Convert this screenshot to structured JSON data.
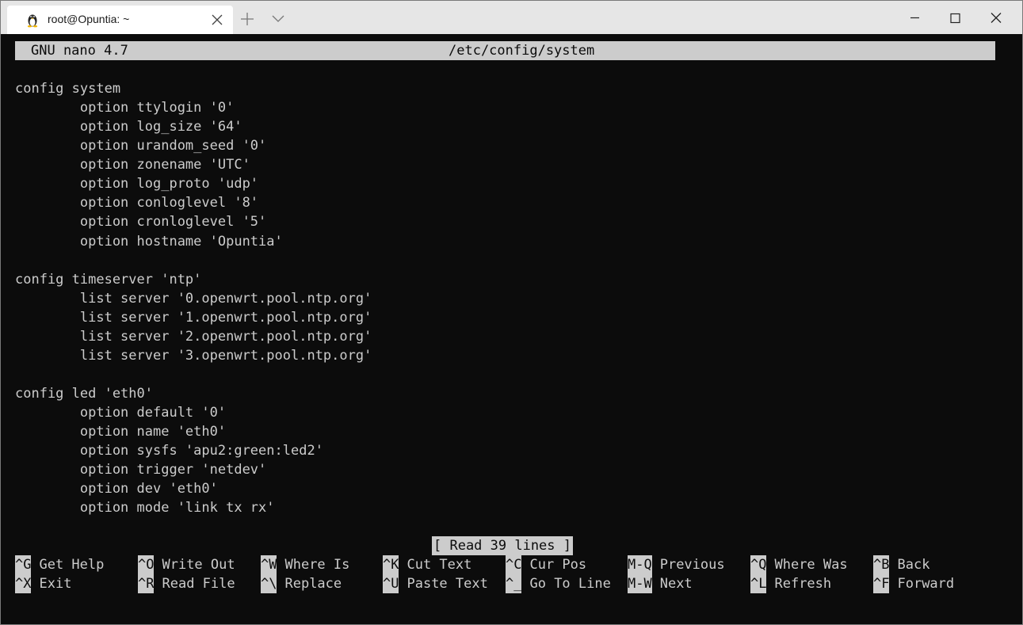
{
  "window": {
    "tab_title": "root@Opuntia: ~"
  },
  "nano": {
    "app_version": "GNU nano 4.7",
    "filename": "/etc/config/system",
    "status": "[ Read 39 lines ]"
  },
  "lines": [
    "config system",
    "        option ttylogin '0'",
    "        option log_size '64'",
    "        option urandom_seed '0'",
    "        option zonename 'UTC'",
    "        option log_proto 'udp'",
    "        option conloglevel '8'",
    "        option cronloglevel '5'",
    "        option hostname 'Opuntia'",
    "",
    "config timeserver 'ntp'",
    "        list server '0.openwrt.pool.ntp.org'",
    "        list server '1.openwrt.pool.ntp.org'",
    "        list server '2.openwrt.pool.ntp.org'",
    "        list server '3.openwrt.pool.ntp.org'",
    "",
    "config led 'eth0'",
    "        option default '0'",
    "        option name 'eth0'",
    "        option sysfs 'apu2:green:led2'",
    "        option trigger 'netdev'",
    "        option dev 'eth0'",
    "        option mode 'link tx rx'"
  ],
  "shortcuts": [
    [
      {
        "key": "^G",
        "label": "Get Help"
      },
      {
        "key": "^O",
        "label": "Write Out"
      },
      {
        "key": "^W",
        "label": "Where Is"
      },
      {
        "key": "^K",
        "label": "Cut Text"
      },
      {
        "key": "^C",
        "label": "Cur Pos"
      },
      {
        "key": "M-Q",
        "label": "Previous"
      },
      {
        "key": "^Q",
        "label": "Where Was"
      },
      {
        "key": "^B",
        "label": "Back"
      }
    ],
    [
      {
        "key": "^X",
        "label": "Exit"
      },
      {
        "key": "^R",
        "label": "Read File"
      },
      {
        "key": "^\\",
        "label": "Replace"
      },
      {
        "key": "^U",
        "label": "Paste Text"
      },
      {
        "key": "^_",
        "label": "Go To Line"
      },
      {
        "key": "M-W",
        "label": "Next"
      },
      {
        "key": "^L",
        "label": "Refresh"
      },
      {
        "key": "^F",
        "label": "Forward"
      }
    ]
  ]
}
